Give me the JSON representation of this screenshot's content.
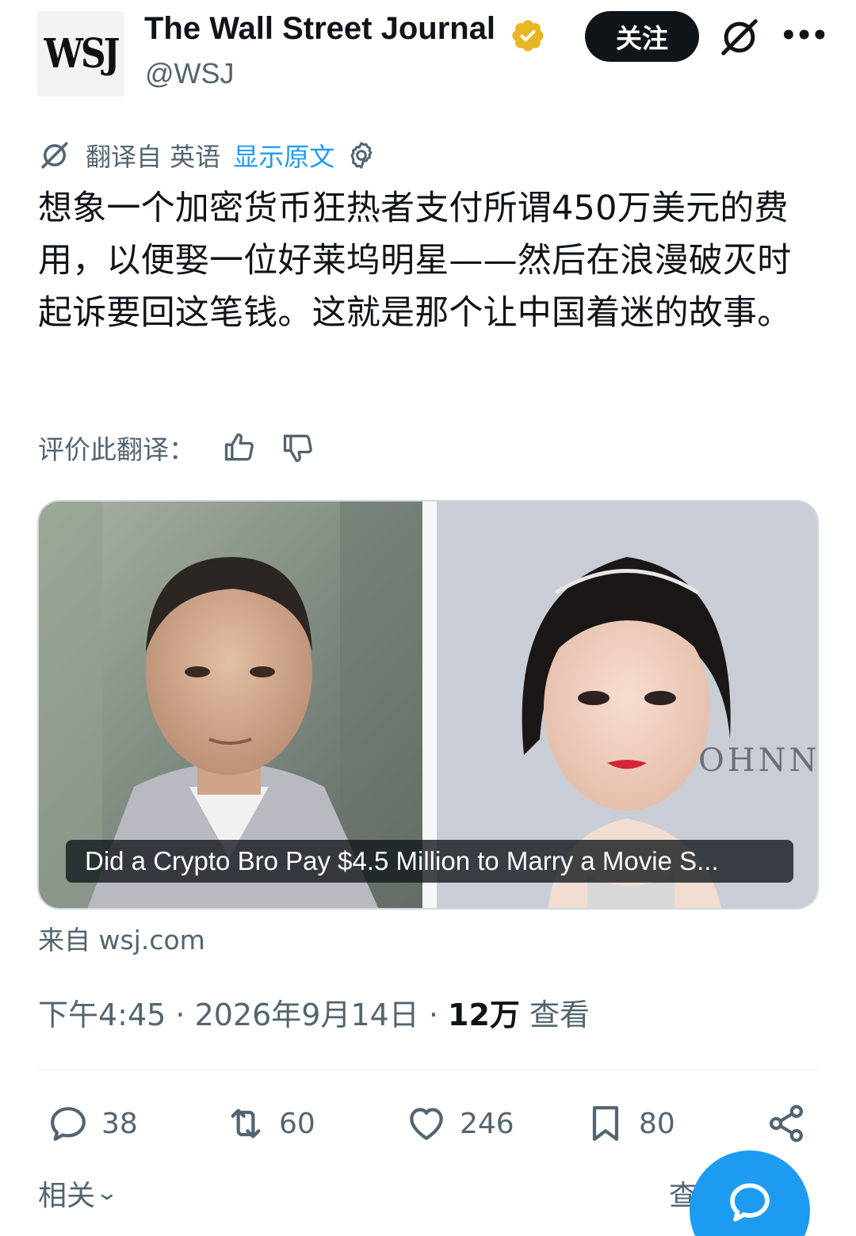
{
  "account": {
    "avatar_text": "WSJ",
    "name": "The Wall Street Journal",
    "handle": "@WSJ",
    "verified_color": "#e8b623",
    "follow_label": "关注"
  },
  "translation": {
    "label": "翻译自 英语",
    "show_original": "显示原文",
    "rate_label": "评价此翻译："
  },
  "tweet": {
    "text": "想象一个加密货币狂热者支付所谓450万美元的费用，以便娶一位好莱坞明星——然后在浪漫破灭时起诉要回这笔钱。这就是那个让中国着迷的故事。"
  },
  "card": {
    "caption": "Did a Crypto Bro Pay $4.5 Million to Marry a Movie S...",
    "source": "来自 wsj.com"
  },
  "meta": {
    "time_date": "下午4:45 · 2026年9月14日 · ",
    "views_count": "12万",
    "views_label": " 查看"
  },
  "actions": {
    "replies": "38",
    "reposts": "60",
    "likes": "246",
    "bookmarks": "80"
  },
  "footer": {
    "related": "相关",
    "right_partial": "查"
  },
  "icons": [
    "verified-badge-icon",
    "grok-icon",
    "more-icon",
    "translate-icon",
    "gear-icon",
    "thumbs-up-icon",
    "thumbs-down-icon",
    "reply-icon",
    "repost-icon",
    "like-icon",
    "bookmark-icon",
    "share-icon",
    "compose-icon"
  ],
  "colors": {
    "accent": "#1d9bf0",
    "text": "#0f1419",
    "secondary": "#536471"
  }
}
